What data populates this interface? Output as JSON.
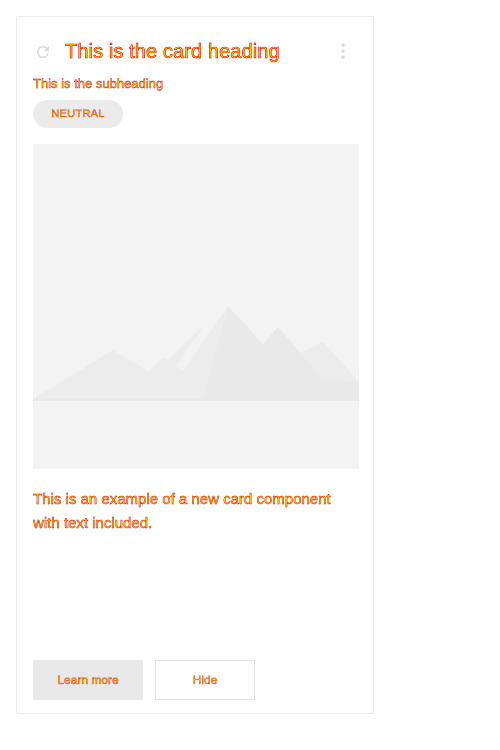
{
  "card": {
    "heading": "This is the card heading",
    "subheading": "This is the subheading",
    "chip_label": "NEUTRAL",
    "body_text": "This is an example of a new card component with text included.",
    "actions": {
      "primary_label": "Learn more",
      "secondary_label": "Hide"
    },
    "icons": {
      "refresh": "refresh-icon",
      "more": "more-vertical-icon",
      "media_placeholder": "image-placeholder-icon"
    }
  },
  "colors": {
    "text_fill": "#ffd400",
    "text_stroke": "#e00000",
    "media_background": "#f3f3f3",
    "chip_background": "#ebebeb"
  }
}
